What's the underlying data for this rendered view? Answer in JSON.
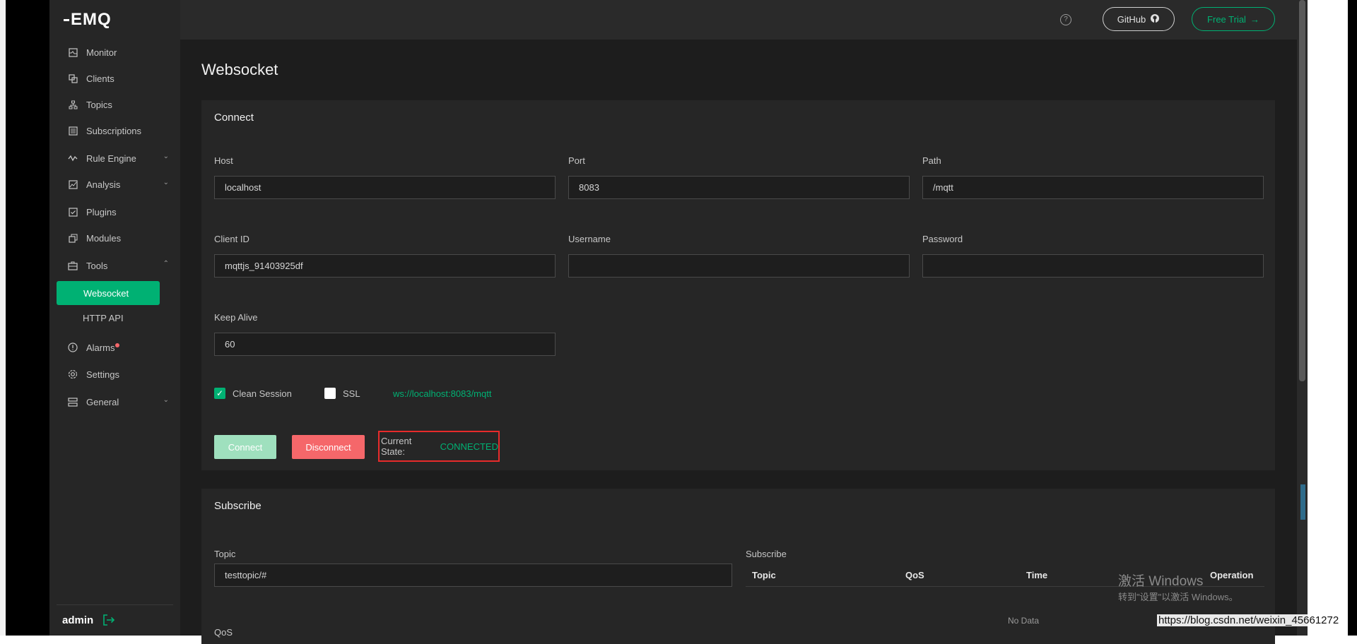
{
  "sidebar": {
    "logo": "EMQ",
    "items": [
      {
        "label": "Monitor",
        "icon": "monitor-icon"
      },
      {
        "label": "Clients",
        "icon": "clients-icon"
      },
      {
        "label": "Topics",
        "icon": "topics-icon"
      },
      {
        "label": "Subscriptions",
        "icon": "subscriptions-icon"
      },
      {
        "label": "Rule Engine",
        "icon": "rule-engine-icon"
      },
      {
        "label": "Analysis",
        "icon": "analysis-icon"
      },
      {
        "label": "Plugins",
        "icon": "plugins-icon"
      },
      {
        "label": "Modules",
        "icon": "modules-icon"
      },
      {
        "label": "Tools",
        "icon": "tools-icon"
      },
      {
        "label": "Alarms",
        "icon": "alarms-icon"
      },
      {
        "label": "Settings",
        "icon": "settings-icon"
      },
      {
        "label": "General",
        "icon": "general-icon"
      }
    ],
    "tools_sub": {
      "active": "Websocket",
      "other": "HTTP API"
    },
    "user": "admin"
  },
  "topbar": {
    "help": "?",
    "github": "GitHub",
    "free_trial": "Free Trial"
  },
  "page": {
    "title": "Websocket"
  },
  "connect": {
    "title": "Connect",
    "host_label": "Host",
    "host": "localhost",
    "port_label": "Port",
    "port": "8083",
    "path_label": "Path",
    "path": "/mqtt",
    "client_id_label": "Client ID",
    "client_id": "mqttjs_91403925df",
    "username_label": "Username",
    "username": "",
    "password_label": "Password",
    "password": "",
    "keepalive_label": "Keep Alive",
    "keepalive": "60",
    "clean_session": "Clean Session",
    "ssl": "SSL",
    "ws_url": "ws://localhost:8083/mqtt",
    "connect_btn": "Connect",
    "disconnect_btn": "Disconnect",
    "state_label": "Current State:",
    "state_value": "CONNECTED"
  },
  "subscribe": {
    "title": "Subscribe",
    "topic_label": "Topic",
    "topic": "testtopic/#",
    "qos_label": "QoS",
    "table_title": "Subscribe",
    "columns": [
      "Topic",
      "QoS",
      "Time",
      "Operation"
    ],
    "no_data": "No Data"
  },
  "watermark": {
    "line1": "激活 Windows",
    "line2": "转到\"设置\"以激活 Windows。"
  },
  "csdn_url": "https://blog.csdn.net/weixin_45661272",
  "colors": {
    "accent": "#00b173",
    "danger": "#f5676a",
    "sidebar": "#262626",
    "main": "#1d1d1d"
  }
}
